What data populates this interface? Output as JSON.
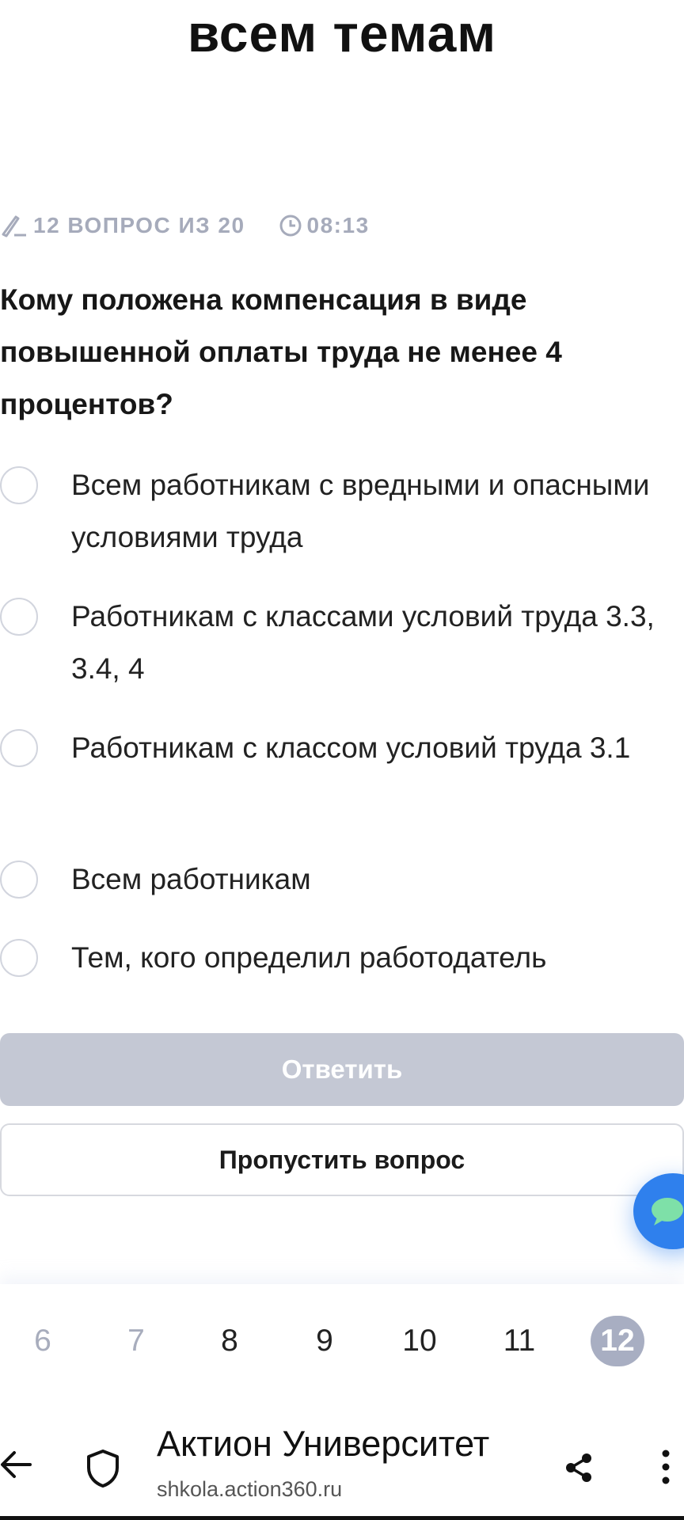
{
  "page": {
    "title_tail": "всем темам"
  },
  "quiz": {
    "progress_text": "12 ВОПРОС ИЗ 20",
    "timer_text": "08:13",
    "question": "Кому положена компенсация в виде повышенной оплаты труда не менее 4 процентов?",
    "options": [
      {
        "label": "Всем работникам с вредными и опасными условиями труда",
        "selected": false
      },
      {
        "label": "Работникам с классами условий труда 3.3, 3.4, 4",
        "selected": false
      },
      {
        "label": "Работникам с классом условий труда 3.1",
        "selected": false
      },
      {
        "label": "Всем работникам",
        "selected": false
      },
      {
        "label": "Тем, кого определил работодатель",
        "selected": false
      }
    ],
    "answer_button": "Ответить",
    "answer_enabled": false,
    "skip_button": "Пропустить вопрос"
  },
  "pager": {
    "pages": [
      "6",
      "7",
      "8",
      "9",
      "10",
      "11",
      "12"
    ],
    "current": "12",
    "visited_dim": [
      "6",
      "7"
    ]
  },
  "browser": {
    "site_title": "Актион Университет",
    "site_url": "shkola.action360.ru",
    "icons": [
      "back-arrow-icon",
      "shield-icon",
      "share-icon",
      "more-vertical-icon"
    ]
  },
  "colors": {
    "accent": "#2f80ed",
    "muted": "#a6abbb",
    "button_disabled": "#c4c8d4",
    "chat_bubble": "#7ee0a8"
  }
}
